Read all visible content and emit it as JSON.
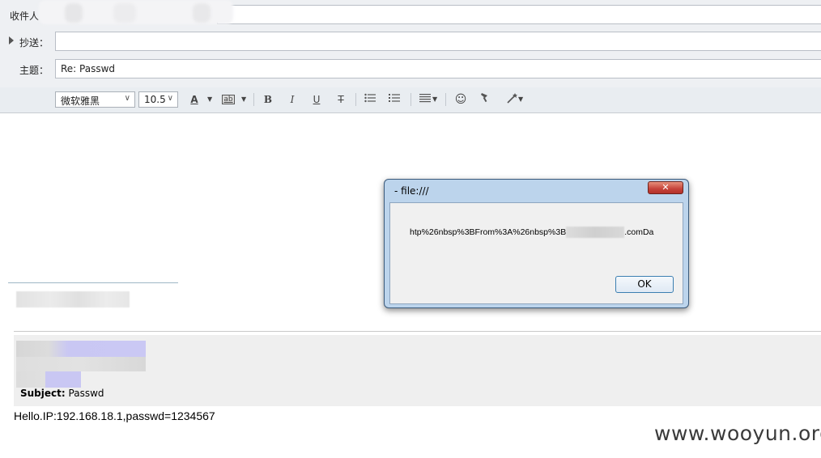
{
  "compose": {
    "to_label": "收件人",
    "cc_label": "抄送：",
    "subject_label": "主题：",
    "subject_value": "Re: Passwd"
  },
  "toolbar": {
    "font_family": "微软雅黑",
    "font_size": "10.5",
    "font_color_glyph": "A",
    "bg_color_glyph": "ab",
    "bold_glyph": "B",
    "italic_glyph": "I",
    "underline_glyph": "U",
    "strike_glyph": "T",
    "icons": [
      "font-color-icon",
      "highlight-icon",
      "bold-icon",
      "italic-icon",
      "underline-icon",
      "strikethrough-icon",
      "bullet-list-icon",
      "numbered-list-icon",
      "align-icon",
      "emoji-icon",
      "format-paint-icon",
      "magic-wand-icon"
    ]
  },
  "quote": {
    "subject_key": "Subject:",
    "subject_value": "Passwd"
  },
  "body_text": "Hello.IP:192.168.18.1,passwd=1234567",
  "dialog": {
    "title": "- file:///",
    "close_glyph": "✕",
    "message_prefix": "htp%26nbsp%3BFrom%3A%26nbsp%3B",
    "message_suffix": ".comDa",
    "ok_label": "OK"
  },
  "watermark": "www.wooyun.org",
  "colors": {
    "header_bg": "#eef0f3",
    "dialog_frame": "#bcd4ec",
    "close_button": "#c6433a",
    "ok_border": "#3c7fb1"
  }
}
